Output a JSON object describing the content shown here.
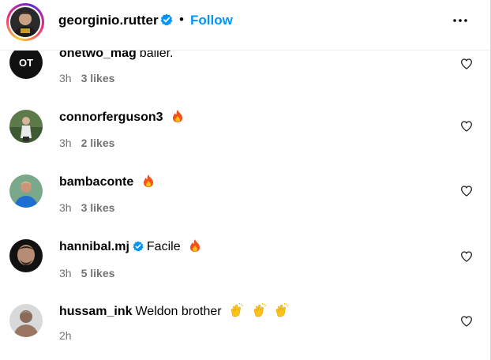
{
  "header": {
    "username": "georginio.rutter",
    "separator": "•",
    "follow_label": "Follow",
    "more_icon": "more-horizontal-icon",
    "verified": true
  },
  "colors": {
    "follow_blue": "#0095f6",
    "meta_gray": "#737373",
    "verified_blue": "#0095f6"
  },
  "comments": [
    {
      "username": "onetwo_mag",
      "text": "baller.",
      "emojis": [],
      "verified": false,
      "time": "3h",
      "likes": "3 likes",
      "avatar_text": "OT"
    },
    {
      "username": "connorferguson3",
      "text": "",
      "emojis": [
        "fire"
      ],
      "verified": false,
      "time": "3h",
      "likes": "2 likes"
    },
    {
      "username": "bambaconte",
      "text": "",
      "emojis": [
        "fire"
      ],
      "verified": false,
      "time": "3h",
      "likes": "3 likes"
    },
    {
      "username": "hannibal.mj",
      "text": "Facile",
      "emojis": [
        "fire"
      ],
      "verified": true,
      "time": "3h",
      "likes": "5 likes"
    },
    {
      "username": "hussam_ink",
      "text": "Weldon brother",
      "emojis": [
        "clapping-hands",
        "clapping-hands",
        "clapping-hands"
      ],
      "verified": false,
      "time": "2h",
      "likes": ""
    }
  ]
}
